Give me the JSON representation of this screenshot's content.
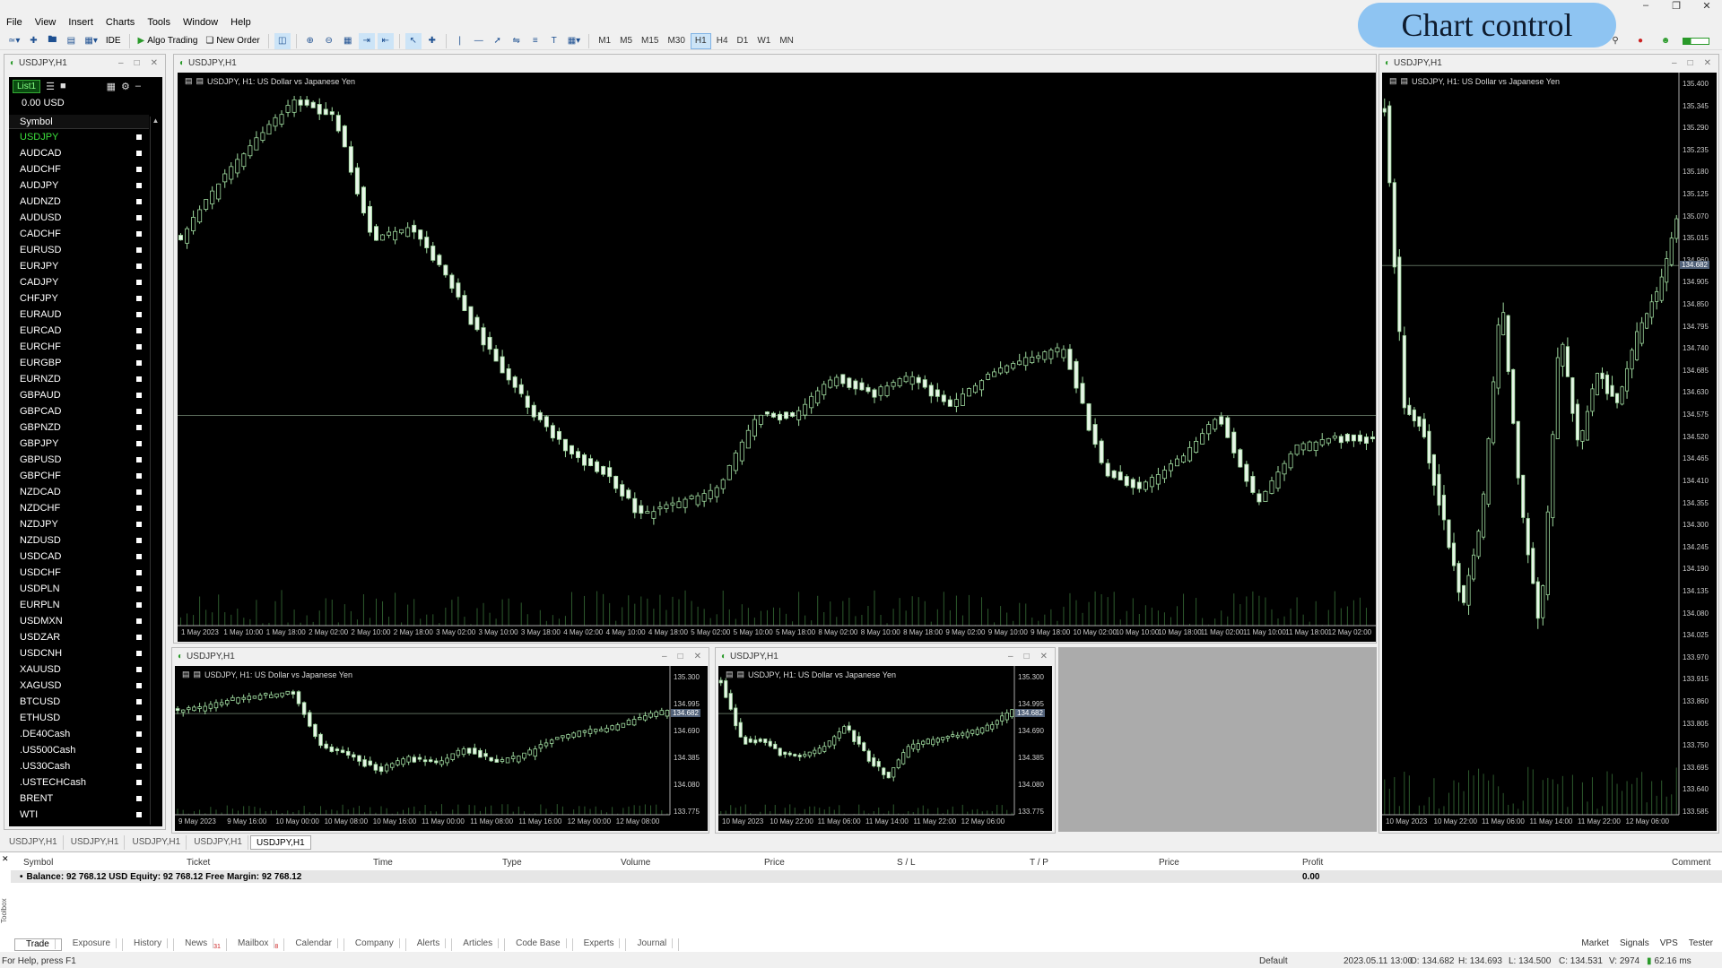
{
  "menu": [
    "File",
    "View",
    "Insert",
    "Charts",
    "Tools",
    "Window",
    "Help"
  ],
  "toolbar": {
    "ide": "IDE",
    "algo_trading": "Algo Trading",
    "new_order": "New Order",
    "timeframes": [
      "M1",
      "M5",
      "M15",
      "M30",
      "H1",
      "H4",
      "D1",
      "W1",
      "MN"
    ],
    "active_timeframe": "H1"
  },
  "overlay": {
    "chart_control": "Chart control"
  },
  "market_watch": {
    "title": "USDJPY,H1",
    "list_tab": "List1",
    "balance": "0.00 USD",
    "header": "Symbol",
    "active_symbol": "USDJPY",
    "symbols": [
      "USDJPY",
      "AUDCAD",
      "AUDCHF",
      "AUDJPY",
      "AUDNZD",
      "AUDUSD",
      "CADCHF",
      "EURUSD",
      "EURJPY",
      "CADJPY",
      "CHFJPY",
      "EURAUD",
      "EURCAD",
      "EURCHF",
      "EURGBP",
      "EURNZD",
      "GBPAUD",
      "GBPCAD",
      "GBPNZD",
      "GBPJPY",
      "GBPUSD",
      "GBPCHF",
      "NZDCAD",
      "NZDCHF",
      "NZDJPY",
      "NZDUSD",
      "USDCAD",
      "USDCHF",
      "USDPLN",
      "EURPLN",
      "USDMXN",
      "USDZAR",
      "USDCNH",
      "XAUUSD",
      "XAGUSD",
      "BTCUSD",
      "ETHUSD",
      ".DE40Cash",
      ".US500Cash",
      ".US30Cash",
      ".USTECHCash",
      "BRENT",
      "WTI"
    ]
  },
  "charts": {
    "main": {
      "title": "USDJPY,H1",
      "label": "USDJPY, H1:  US Dollar vs Japanese Yen",
      "x_labels": [
        "1 May 2023",
        "1 May 10:00",
        "1 May 18:00",
        "2 May 02:00",
        "2 May 10:00",
        "2 May 18:00",
        "3 May 02:00",
        "3 May 10:00",
        "3 May 18:00",
        "4 May 02:00",
        "4 May 10:00",
        "4 May 18:00",
        "5 May 02:00",
        "5 May 10:00",
        "5 May 18:00",
        "8 May 02:00",
        "8 May 10:00",
        "8 May 18:00",
        "9 May 02:00",
        "9 May 10:00",
        "9 May 18:00",
        "10 May 02:00",
        "10 May 10:00",
        "10 May 18:00",
        "11 May 02:00",
        "11 May 10:00",
        "11 May 18:00",
        "12 May 02:00"
      ]
    },
    "small1": {
      "title": "USDJPY,H1",
      "label": "USDJPY, H1:  US Dollar vs Japanese Yen",
      "y_labels": [
        "135.300",
        "134.995",
        "134.690",
        "134.385",
        "134.080",
        "133.775"
      ],
      "price_tag": "134.682",
      "x_labels": [
        "9 May 2023",
        "9 May 16:00",
        "10 May 00:00",
        "10 May 08:00",
        "10 May 16:00",
        "11 May 00:00",
        "11 May 08:00",
        "11 May 16:00",
        "12 May 00:00",
        "12 May 08:00"
      ]
    },
    "small2": {
      "title": "USDJPY,H1",
      "label": "USDJPY, H1:  US Dollar vs Japanese Yen",
      "y_labels": [
        "135.300",
        "134.995",
        "134.690",
        "134.385",
        "134.080",
        "133.775"
      ],
      "price_tag": "134.682",
      "x_labels": [
        "10 May 2023",
        "10 May 22:00",
        "11 May 06:00",
        "11 May 14:00",
        "11 May 22:00",
        "12 May 06:00"
      ]
    },
    "right": {
      "title": "USDJPY,H1",
      "label": "USDJPY, H1:  US Dollar vs Japanese Yen",
      "y_labels": [
        "135.400",
        "135.345",
        "135.290",
        "135.235",
        "135.180",
        "135.125",
        "135.070",
        "135.015",
        "134.960",
        "134.905",
        "134.850",
        "134.795",
        "134.740",
        "134.685",
        "134.630",
        "134.575",
        "134.520",
        "134.465",
        "134.410",
        "134.355",
        "134.300",
        "134.245",
        "134.190",
        "134.135",
        "134.080",
        "134.025",
        "133.970",
        "133.915",
        "133.860",
        "133.805",
        "133.750",
        "133.695",
        "133.640",
        "133.585"
      ],
      "price_tag": "134.682",
      "x_labels": [
        "10 May 2023",
        "10 May 22:00",
        "11 May 06:00",
        "11 May 14:00",
        "11 May 22:00",
        "12 May 06:00"
      ]
    }
  },
  "chart_tabs": [
    "USDJPY,H1",
    "USDJPY,H1",
    "USDJPY,H1",
    "USDJPY,H1",
    "USDJPY,H1"
  ],
  "active_chart_tab_index": 4,
  "toolbox": {
    "side_label": "Toolbox",
    "columns": [
      "Symbol",
      "Ticket",
      "Time",
      "Type",
      "Volume",
      "Price",
      "S / L",
      "T / P",
      "Price",
      "Profit",
      "Comment"
    ],
    "balance_line": "Balance: 92 768.12 USD  Equity: 92 768.12  Free Margin: 92 768.12",
    "profit": "0.00",
    "tabs": [
      "Trade",
      "Exposure",
      "History",
      "News",
      "Mailbox",
      "Calendar",
      "Company",
      "Alerts",
      "Articles",
      "Code Base",
      "Experts",
      "Journal"
    ],
    "news_count": "31",
    "mailbox_count": "8",
    "right_items": [
      "Market",
      "Signals",
      "VPS",
      "Tester"
    ]
  },
  "status": {
    "help": "For Help, press F1",
    "profile": "Default",
    "datetime": "2023.05.11 13:00",
    "open": "O: 134.682",
    "high": "H: 134.693",
    "low": "L: 134.500",
    "close": "C: 134.531",
    "volume": "V: 2974",
    "ping": "62.16 ms"
  }
}
